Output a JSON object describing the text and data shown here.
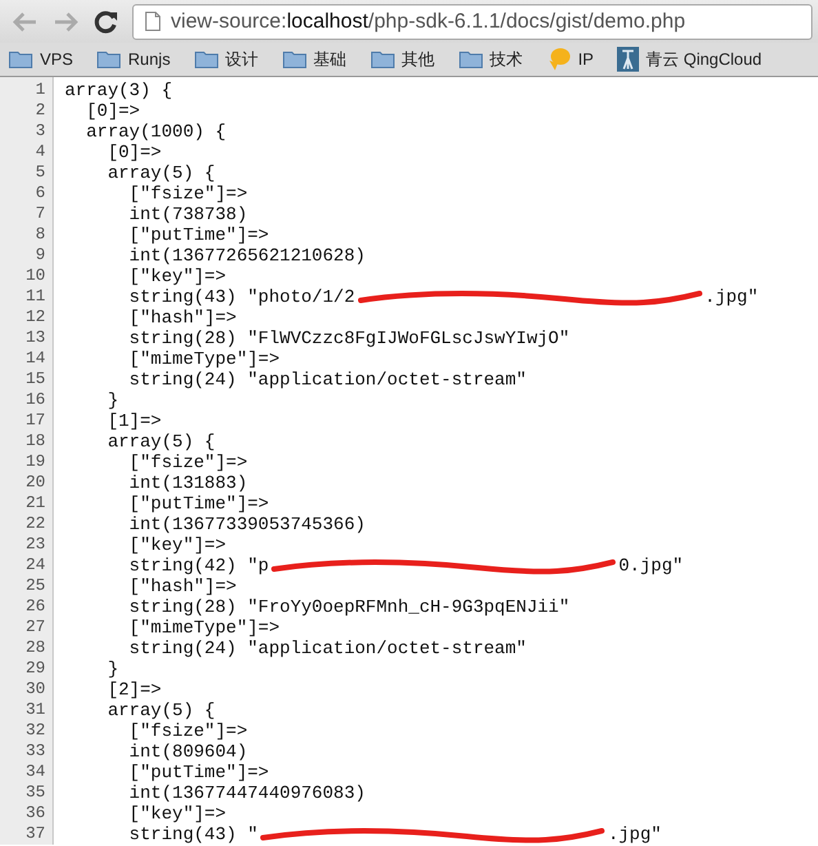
{
  "toolbar": {
    "back_disabled": true,
    "forward_disabled": true,
    "url": [
      {
        "text": "view-source:",
        "strong": false
      },
      {
        "text": "localhost",
        "strong": true
      },
      {
        "text": "/php-sdk-6.1.1/docs/gist/demo.php",
        "strong": false
      }
    ]
  },
  "bookmarks": [
    {
      "kind": "folder",
      "label": "VPS"
    },
    {
      "kind": "folder",
      "label": "Runjs"
    },
    {
      "kind": "folder",
      "label": "设计"
    },
    {
      "kind": "folder",
      "label": "基础"
    },
    {
      "kind": "folder",
      "label": "其他"
    },
    {
      "kind": "folder",
      "label": "技术"
    },
    {
      "kind": "bubble",
      "label": "IP"
    },
    {
      "kind": "tower",
      "label": "青云 QingCloud"
    }
  ],
  "source_lines": [
    {
      "number": "1",
      "text": "array(3) {"
    },
    {
      "number": "2",
      "text": "  [0]=>"
    },
    {
      "number": "3",
      "text": "  array(1000) {"
    },
    {
      "number": "4",
      "text": "    [0]=>"
    },
    {
      "number": "5",
      "text": "    array(5) {"
    },
    {
      "number": "6",
      "text": "      [\"fsize\"]=>"
    },
    {
      "number": "7",
      "text": "      int(738738)"
    },
    {
      "number": "8",
      "text": "      [\"putTime\"]=>"
    },
    {
      "number": "9",
      "text": "      int(13677265621210628)"
    },
    {
      "number": "10",
      "text": "      [\"key\"]=>"
    },
    {
      "number": "11",
      "text": "      string(43) \"photo/1/2",
      "redacted": true,
      "tail": ".jpg\""
    },
    {
      "number": "12",
      "text": "      [\"hash\"]=>"
    },
    {
      "number": "13",
      "text": "      string(28) \"FlWVCzzc8FgIJWoFGLscJswYIwjO\""
    },
    {
      "number": "14",
      "text": "      [\"mimeType\"]=>"
    },
    {
      "number": "15",
      "text": "      string(24) \"application/octet-stream\""
    },
    {
      "number": "16",
      "text": "    }"
    },
    {
      "number": "17",
      "text": "    [1]=>"
    },
    {
      "number": "18",
      "text": "    array(5) {"
    },
    {
      "number": "19",
      "text": "      [\"fsize\"]=>"
    },
    {
      "number": "20",
      "text": "      int(131883)"
    },
    {
      "number": "21",
      "text": "      [\"putTime\"]=>"
    },
    {
      "number": "22",
      "text": "      int(13677339053745366)"
    },
    {
      "number": "23",
      "text": "      [\"key\"]=>"
    },
    {
      "number": "24",
      "text": "      string(42) \"p",
      "redacted": true,
      "tail": "0.jpg\""
    },
    {
      "number": "25",
      "text": "      [\"hash\"]=>"
    },
    {
      "number": "26",
      "text": "      string(28) \"FroYy0oepRFMnh_cH-9G3pqENJii\""
    },
    {
      "number": "27",
      "text": "      [\"mimeType\"]=>"
    },
    {
      "number": "28",
      "text": "      string(24) \"application/octet-stream\""
    },
    {
      "number": "29",
      "text": "    }"
    },
    {
      "number": "30",
      "text": "    [2]=>"
    },
    {
      "number": "31",
      "text": "    array(5) {"
    },
    {
      "number": "32",
      "text": "      [\"fsize\"]=>"
    },
    {
      "number": "33",
      "text": "      int(809604)"
    },
    {
      "number": "34",
      "text": "      [\"putTime\"]=>"
    },
    {
      "number": "35",
      "text": "      int(13677447440976083)"
    },
    {
      "number": "36",
      "text": "      [\"key\"]=>"
    },
    {
      "number": "37",
      "text": "      string(43) \"",
      "redacted": true,
      "tail": ".jpg\""
    }
  ]
}
